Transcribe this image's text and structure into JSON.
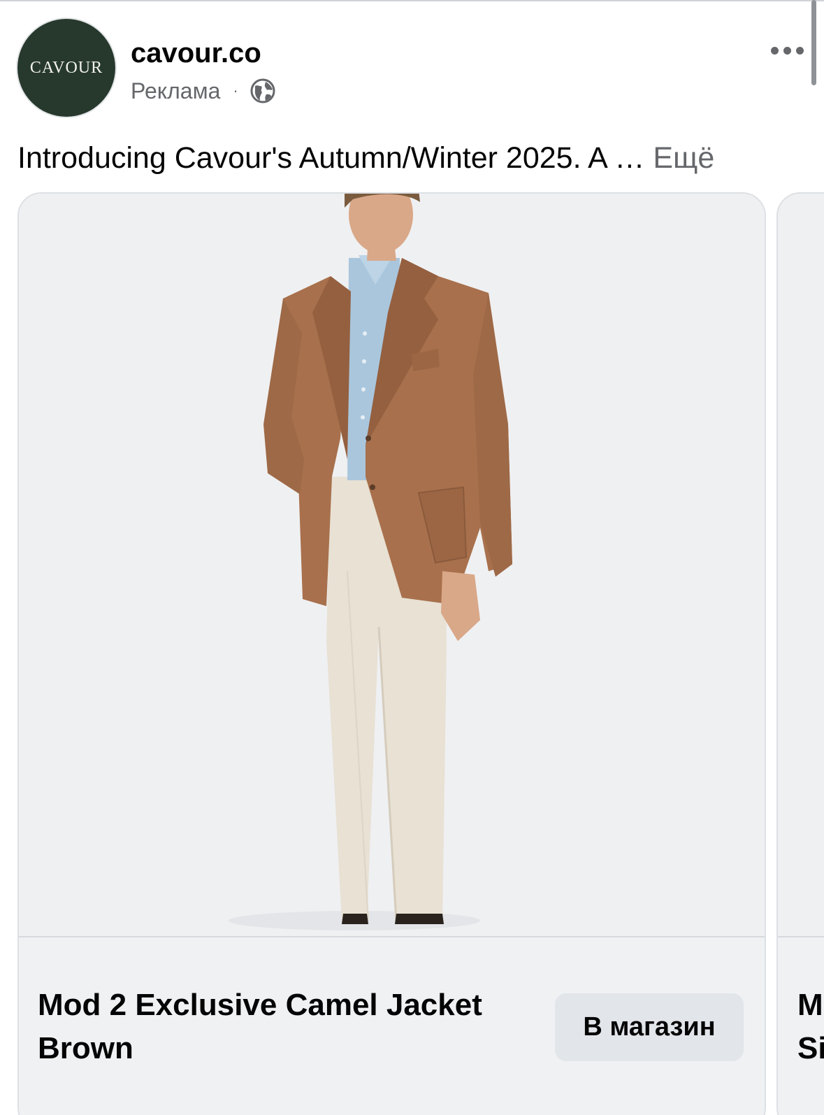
{
  "post": {
    "account_name": "cavour.co",
    "avatar_text": "CAVOUR",
    "sponsored_label": "Реклама",
    "separator": "·",
    "privacy_icon": "globe-icon",
    "more_icon": "more-horizontal-icon",
    "caption": "Introducing Cavour's Autumn/Winter 2025. A … ",
    "caption_more": "Ещё"
  },
  "carousel": {
    "cards": [
      {
        "image_icon": "product-photo-man-in-camel-jacket",
        "title": "Mod 2 Exclusive Camel Jacket Brown",
        "cta": "В магазин"
      },
      {
        "title_partial": "M\nSi"
      }
    ]
  },
  "colors": {
    "avatar_bg": "#27392c",
    "card_bg": "#eff0f2",
    "button_bg": "#e2e5e9",
    "secondary_text": "#65676b",
    "jacket": "#a8704c",
    "shirt": "#aac6dc",
    "trousers": "#e8e1d4"
  }
}
